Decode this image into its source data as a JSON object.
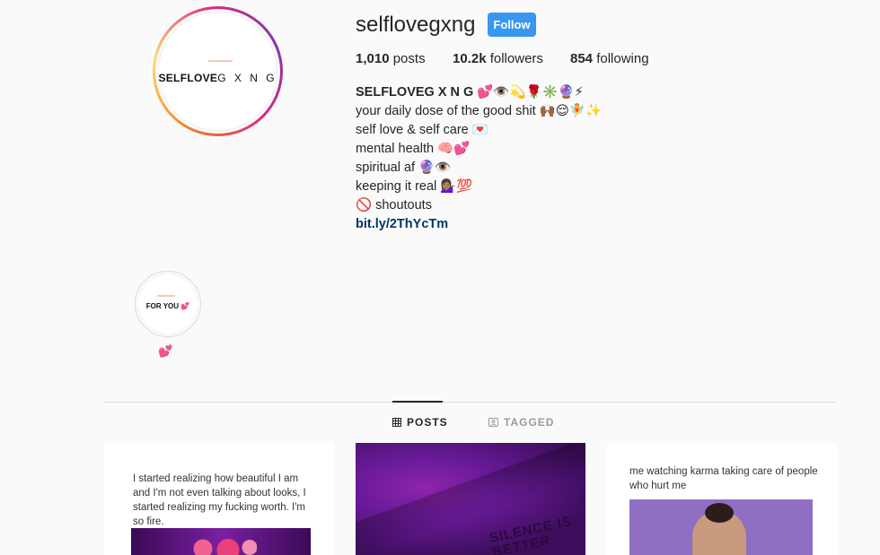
{
  "profile": {
    "avatar_text_bold": "SELFLOVE",
    "avatar_text_light": "G X N G",
    "username": "selflovegxng",
    "follow_label": "Follow",
    "stats": {
      "posts_count": "1,010",
      "posts_label": "posts",
      "followers_count": "10.2k",
      "followers_label": "followers",
      "following_count": "854",
      "following_label": "following"
    },
    "bio": {
      "name": "SELFLOVEG X N G 💕👁️💫🌹✳️🔮⚡",
      "lines": [
        "your daily dose of the good shit 🙌🏾😌🧚✨",
        "self love & self care 💌",
        "mental health 🧠💕",
        "spiritual af 🔮👁️",
        "keeping it real 💁🏽‍♀️💯",
        "🚫 shoutouts"
      ],
      "link": "bit.ly/2ThYcTm"
    }
  },
  "highlight": {
    "text": "FOR YOU 💕",
    "label": "💕"
  },
  "tabs": {
    "posts": "POSTS",
    "tagged": "TAGGED"
  },
  "posts": [
    {
      "caption": "I started realizing how beautiful I am and I'm not even talking about looks, I started realizing my fucking worth. I'm so fire."
    },
    {
      "caption": "SILENCE IS BETTER"
    },
    {
      "caption": "me watching karma taking care of people who hurt me"
    }
  ]
}
